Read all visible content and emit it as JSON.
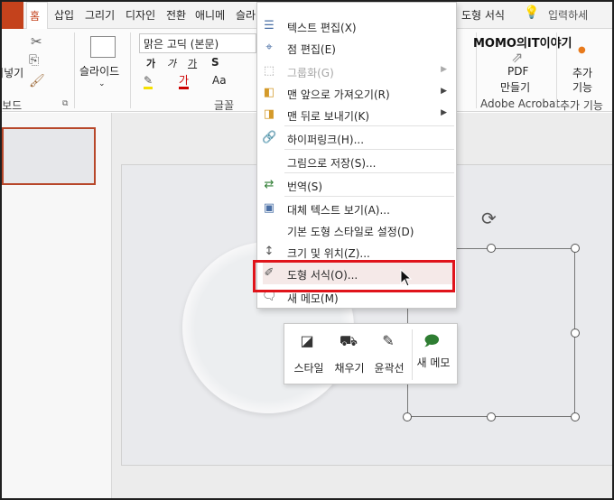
{
  "tabs": {
    "home": "홈",
    "insert": "삽입",
    "draw": "그리기",
    "design": "디자인",
    "transitions": "전환",
    "animations": "애니메",
    "slideshow": "슬라",
    "shape_format": "도형 서식",
    "tell_me": "입력하세"
  },
  "ribbon": {
    "paste_partial": "붙여넣기",
    "clipboard_label_partial": "클립보드",
    "new_slide": "슬라이드",
    "font_name": "맑은 고딕 (본문)",
    "font_group_label": "글꼴",
    "font_size_label": "Aa",
    "bold": "가",
    "italic": "가",
    "strike": "S",
    "shadow": "가",
    "pdf_label_1": "PDF",
    "pdf_label_2": "만들기",
    "acrobat_label": "Adobe Acrobat",
    "addin_1": "추가",
    "addin_2": "기능",
    "addin_group": "추가 기능",
    "watermark": "MOMO의IT이야기"
  },
  "context_menu": {
    "items": [
      {
        "label": "텍스트 편집(X)",
        "icon": "text-edit-icon",
        "disabled": false,
        "submenu": false
      },
      {
        "label": "점 편집(E)",
        "icon": "edit-points-icon",
        "disabled": false,
        "submenu": false
      },
      {
        "label": "그룹화(G)",
        "icon": "group-icon",
        "disabled": true,
        "submenu": true
      },
      {
        "label": "맨 앞으로 가져오기(R)",
        "icon": "bring-front-icon",
        "disabled": false,
        "submenu": true
      },
      {
        "label": "맨 뒤로 보내기(K)",
        "icon": "send-back-icon",
        "disabled": false,
        "submenu": true
      },
      {
        "label": "하이퍼링크(H)...",
        "icon": "hyperlink-icon",
        "disabled": false,
        "submenu": false
      },
      {
        "label": "그림으로 저장(S)...",
        "icon": "",
        "disabled": false,
        "submenu": false
      },
      {
        "label": "번역(S)",
        "icon": "translate-icon",
        "disabled": false,
        "submenu": false
      },
      {
        "label": "대체 텍스트 보기(A)...",
        "icon": "alt-text-icon",
        "disabled": false,
        "submenu": false
      },
      {
        "label": "기본 도형 스타일로 설정(D)",
        "icon": "",
        "disabled": false,
        "submenu": false
      },
      {
        "label": "크기 및 위치(Z)...",
        "icon": "size-position-icon",
        "disabled": false,
        "submenu": false
      },
      {
        "label": "도형 서식(O)...",
        "icon": "format-shape-icon",
        "disabled": false,
        "submenu": false
      },
      {
        "label": "새 메모(M)",
        "icon": "new-comment-icon",
        "disabled": false,
        "submenu": false
      }
    ]
  },
  "mini_toolbar": {
    "style": "스타일",
    "fill": "채우기",
    "outline": "윤곽선",
    "new_comment": "새 메모"
  },
  "colors": {
    "accent": "#c4421c",
    "highlight_border": "#e0141b",
    "selection_thumb": "#b7472a"
  }
}
